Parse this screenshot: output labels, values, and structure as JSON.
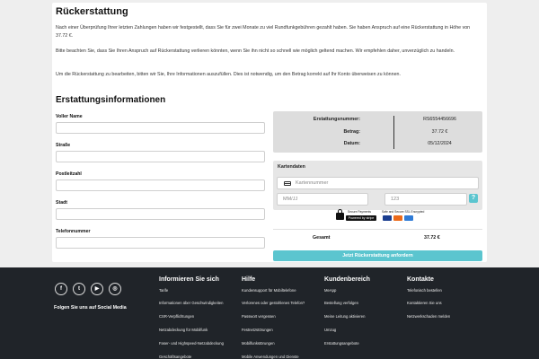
{
  "refund": {
    "title": "Rückerstattung",
    "paragraphs": [
      "Nach einer Überprüfung Ihrer letzten Zahlungen haben wir festgestellt, dass Sie für zwei Monate zu viel Rundfunkgebühren gezahlt haben. Sie haben Anspruch auf eine Rückerstattung in Höhe von 37.72 €.",
      "Bitte beachten Sie, dass Sie Ihren Anspruch auf Rückerstattung verlieren könnten, wenn Sie ihn nicht so schnell wie möglich geltend machen. Wir empfehlen daher, unverzüglich zu handeln.",
      "Um die Rückerstattung zu bearbeiten, bitten wir Sie, Ihre Informationen auszufüllen. Dies ist notwendig, um den Betrag korrekt auf Ihr Konto überweisen zu können."
    ]
  },
  "form": {
    "title": "Erstattungsinformationen",
    "fields": [
      {
        "label": "Voller Name",
        "value": ""
      },
      {
        "label": "Straße",
        "value": ""
      },
      {
        "label": "Postleitzahl",
        "value": ""
      },
      {
        "label": "Stadt",
        "value": ""
      },
      {
        "label": "Telefonnummer",
        "value": ""
      }
    ]
  },
  "summary": {
    "rows": [
      {
        "label": "Erstattungsnummer:",
        "value": "RS6554456696"
      },
      {
        "label": "Betrag:",
        "value": "37.72 €"
      },
      {
        "label": "Datum:",
        "value": "05/12/2024"
      }
    ]
  },
  "card": {
    "title": "Kartendaten",
    "number_placeholder": "Kartennummer",
    "expiry_placeholder": "MM/JJ",
    "cvc_placeholder": "123",
    "help": "?",
    "icon": "credit-card-icon"
  },
  "badges": {
    "secure_label": "Secure Payments",
    "powered_label": "Powered by stripe",
    "ssl_label": "Safe and Secure SSL Encrypted"
  },
  "total": {
    "label": "Gesamt",
    "value": "37.72 €"
  },
  "submit_label": "Jetzt Rückerstattung anfordern",
  "footer": {
    "social": [
      "f",
      "t",
      "▶",
      "◎"
    ],
    "social_caption": "Folgen Sie uns auf Social Media",
    "columns": [
      {
        "title": "Informieren Sie sich",
        "items": [
          "Tarife",
          "Informationen über Geschwindigkeiten",
          "CSR-Verpflichtungen",
          "Netzabdeckung für Mobilfunk",
          "Faser- und Highspeed-Netzabdeckung",
          "Geschäftsangebote"
        ]
      },
      {
        "title": "Hilfe",
        "items": [
          "Kundensupport für Mobiltelefone",
          "Verlorenes oder gestohlenes Telefon?",
          "Passwort vergessen",
          "Festnetzstörungen",
          "Mobilfunkstörungen",
          "Mobile Anwendungen und Dienste"
        ]
      },
      {
        "title": "Kundenbereich",
        "items": [
          "MeApp",
          "Bestellung verfolgen",
          "Meine Leitung aktivieren",
          "Umzug",
          "Erstattungsangebote"
        ]
      },
      {
        "title": "Kontakte",
        "items": [
          "Telefonisch bestellen",
          "Kontaktieren Sie uns",
          "Netzwerkschaden melden"
        ]
      }
    ]
  },
  "colors": {
    "accent": "#5bc5cf",
    "footer_bg": "#202429"
  }
}
